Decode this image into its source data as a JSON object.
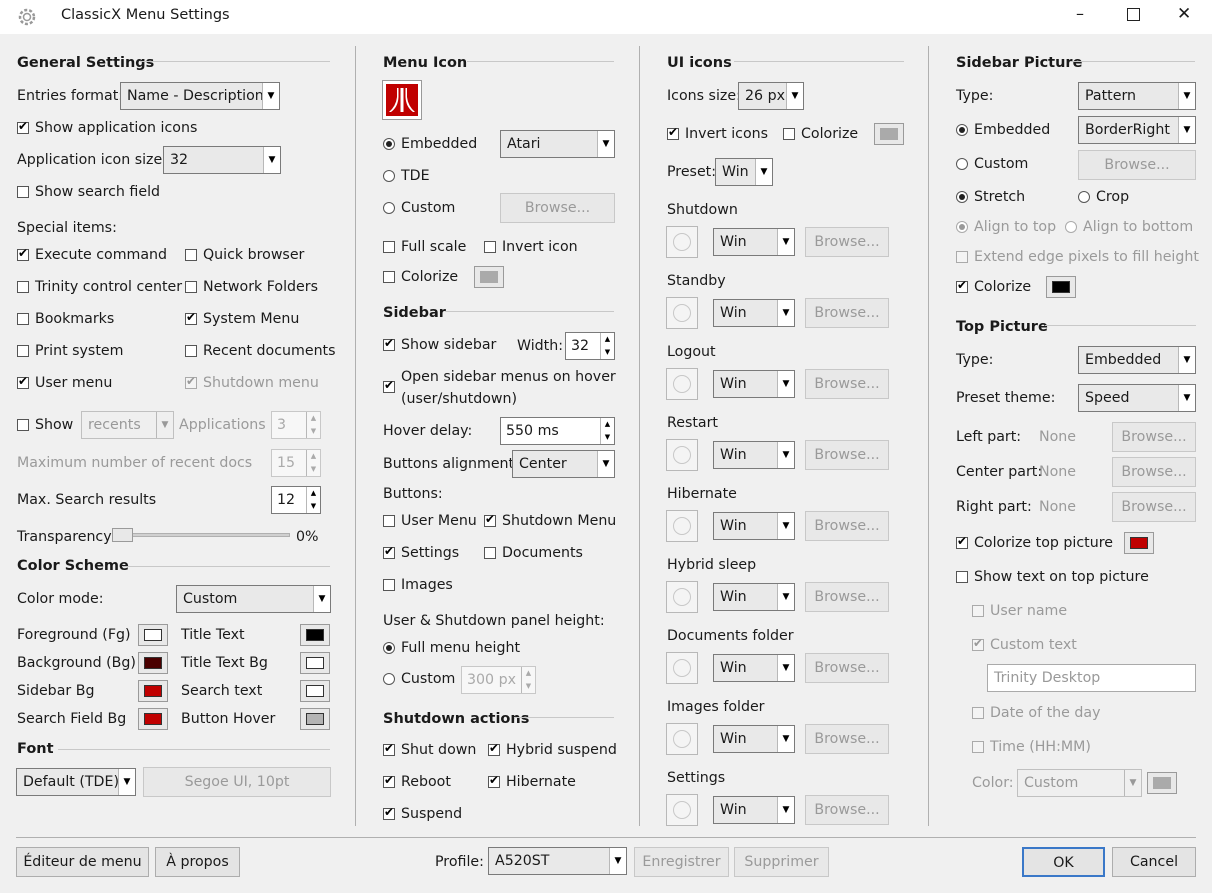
{
  "window": {
    "title": "ClassicX Menu Settings",
    "minimize": "–",
    "maximize": "☐",
    "close": "✕"
  },
  "general": {
    "title": "General Settings",
    "entries_format_label": "Entries format:",
    "entries_format_value": "Name - Description",
    "show_app_icons": "Show application icons",
    "app_icon_size_label": "Application icon size:",
    "app_icon_size_value": "32",
    "show_search": "Show search field",
    "special_items": "Special items:",
    "execute_command": "Execute command",
    "quick_browser": "Quick browser",
    "trinity_cc": "Trinity control center",
    "network_folders": "Network Folders",
    "bookmarks": "Bookmarks",
    "system_menu": "System Menu",
    "print_system": "Print system",
    "recent_documents": "Recent documents",
    "user_menu": "User menu",
    "shutdown_menu": "Shutdown menu",
    "show": "Show",
    "recents": "recents",
    "applications": "Applications",
    "applications_value": "3",
    "max_recent_docs": "Maximum number of recent docs",
    "max_recent_value": "15",
    "max_search_label": "Max. Search results",
    "max_search_value": "12",
    "transparency_label": "Transparency:",
    "transparency_value": "0%"
  },
  "color_scheme": {
    "title": "Color Scheme",
    "color_mode_label": "Color mode:",
    "color_mode_value": "Custom",
    "fg": "Foreground (Fg)",
    "title_text": "Title Text",
    "bg": "Background (Bg)",
    "title_text_bg": "Title Text Bg",
    "sidebar_bg": "Sidebar Bg",
    "search_text": "Search text",
    "search_field_bg": "Search Field Bg",
    "button_hover": "Button Hover",
    "colors": {
      "fg": "#ffffff",
      "title_text": "#000000",
      "bg": "#4a0000",
      "title_text_bg": "#ffffff",
      "sidebar_bg": "#c00000",
      "search_text": "#ffffff",
      "search_field_bg": "#c00000",
      "button_hover": "#b4b4b4"
    }
  },
  "font": {
    "title": "Font",
    "font_combo": "Default (TDE)",
    "font_button": "Segoe UI, 10pt"
  },
  "menu_icon": {
    "title": "Menu Icon",
    "embedded": "Embedded",
    "embedded_value": "Atari",
    "tde": "TDE",
    "custom": "Custom",
    "browse": "Browse...",
    "full_scale": "Full scale",
    "invert_icon": "Invert icon",
    "colorize": "Colorize"
  },
  "sidebar": {
    "title": "Sidebar",
    "show_sidebar": "Show sidebar",
    "width_label": "Width:",
    "width_value": "32",
    "open_on_hover_1": "Open sidebar menus on hover",
    "open_on_hover_2": "(user/shutdown)",
    "hover_delay_label": "Hover delay:",
    "hover_delay_value": "550 ms",
    "buttons_alignment_label": "Buttons alignment:",
    "buttons_alignment_value": "Center",
    "buttons_label": "Buttons:",
    "user_menu": "User Menu",
    "shutdown_menu": "Shutdown Menu",
    "settings": "Settings",
    "documents": "Documents",
    "images": "Images",
    "panel_height_label": "User & Shutdown panel height:",
    "full_menu_height": "Full menu height",
    "custom": "Custom",
    "custom_value": "300 px"
  },
  "shutdown_actions": {
    "title": "Shutdown actions",
    "shut_down": "Shut down",
    "hybrid_suspend": "Hybrid suspend",
    "reboot": "Reboot",
    "hibernate": "Hibernate",
    "suspend": "Suspend"
  },
  "ui_icons": {
    "title": "UI icons",
    "icons_size_label": "Icons size:",
    "icons_size_value": "26 px",
    "invert_icons": "Invert icons",
    "colorize": "Colorize",
    "preset_label": "Preset:",
    "preset_value": "Win",
    "browse": "Browse...",
    "items": [
      {
        "label": "Shutdown",
        "value": "Win"
      },
      {
        "label": "Standby",
        "value": "Win"
      },
      {
        "label": "Logout",
        "value": "Win"
      },
      {
        "label": "Restart",
        "value": "Win"
      },
      {
        "label": "Hibernate",
        "value": "Win"
      },
      {
        "label": "Hybrid sleep",
        "value": "Win"
      },
      {
        "label": "Documents folder",
        "value": "Win"
      },
      {
        "label": "Images folder",
        "value": "Win"
      },
      {
        "label": "Settings",
        "value": "Win"
      }
    ]
  },
  "sidebar_picture": {
    "title": "Sidebar Picture",
    "type_label": "Type:",
    "type_value": "Pattern",
    "embedded": "Embedded",
    "embedded_value": "BorderRight",
    "custom": "Custom",
    "browse": "Browse...",
    "stretch": "Stretch",
    "crop": "Crop",
    "align_top": "Align to top",
    "align_bottom": "Align to bottom",
    "extend_edge": "Extend edge pixels to fill height",
    "colorize": "Colorize",
    "colorize_color": "#000000"
  },
  "top_picture": {
    "title": "Top Picture",
    "type_label": "Type:",
    "type_value": "Embedded",
    "preset_label": "Preset theme:",
    "preset_value": "Speed",
    "left_part": "Left part:",
    "center_part": "Center part:",
    "right_part": "Right part:",
    "none": "None",
    "browse": "Browse...",
    "colorize_top": "Colorize top picture",
    "colorize_color": "#c00000",
    "show_text": "Show text on top picture",
    "user_name": "User name",
    "custom_text": "Custom text",
    "custom_text_value": "Trinity Desktop",
    "date_of_day": "Date of the day",
    "time": "Time (HH:MM)",
    "color_label": "Color:",
    "color_value": "Custom"
  },
  "footer": {
    "menu_editor": "Éditeur de menu",
    "about": "À propos",
    "profile_label": "Profile:",
    "profile_value": "A520ST",
    "save": "Enregistrer",
    "delete": "Supprimer",
    "ok": "OK",
    "cancel": "Cancel"
  }
}
